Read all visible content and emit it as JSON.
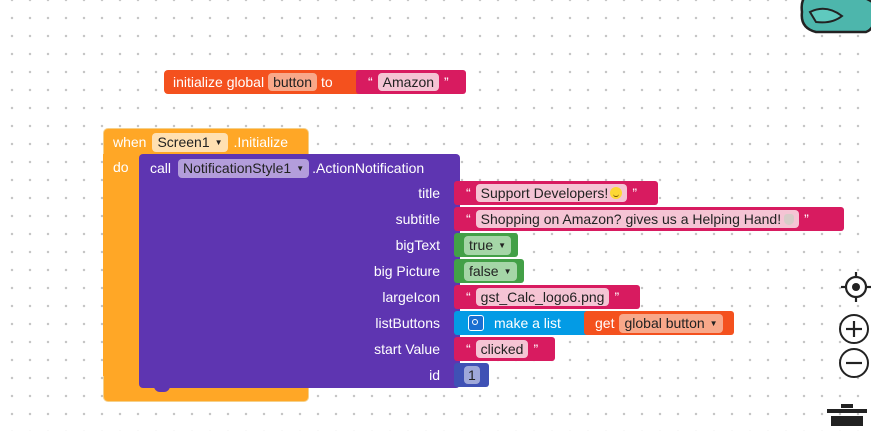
{
  "init_block": {
    "keyword": "initialize global",
    "var_name": "button",
    "to_label": "to",
    "value": "Amazon"
  },
  "event_block": {
    "when_label": "when",
    "component": "Screen1",
    "event": ".Initialize",
    "do_label": "do"
  },
  "call_block": {
    "call_label": "call",
    "component": "NotificationStyle1",
    "method": ".ActionNotification",
    "params": {
      "title": {
        "label": "title",
        "value": "Support Developers!"
      },
      "subtitle": {
        "label": "subtitle",
        "value": "Shopping on Amazon? gives us a Helping Hand!"
      },
      "bigText": {
        "label": "bigText",
        "value": "true"
      },
      "bigPicture": {
        "label": "big Picture",
        "value": "false"
      },
      "largeIcon": {
        "label": "largeIcon",
        "value": "gst_Calc_logo6.png"
      },
      "listButtons": {
        "label": "listButtons",
        "make_list": "make a list",
        "get_label": "get",
        "get_var": "global button"
      },
      "startValue": {
        "label": "start Value",
        "value": "clicked"
      },
      "id": {
        "label": "id",
        "value": "1"
      }
    }
  },
  "colors": {
    "text_block": "#d81b60",
    "logic_block": "#43a047",
    "event_block": "#ffa726",
    "component_block": "#5e35b1",
    "variable_block": "#f4511e",
    "list_block": "#039be5",
    "math_block": "#3f51b5"
  },
  "workspace_controls": [
    "recenter-icon",
    "zoom-in-icon",
    "zoom-out-icon",
    "trash-icon"
  ]
}
